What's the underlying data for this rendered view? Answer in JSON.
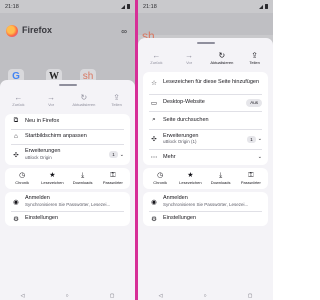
{
  "left": {
    "status": {
      "time": "21:18"
    },
    "home": {
      "brand": "Firefox"
    },
    "nav": [
      {
        "icon": "arrow-left",
        "glyph": "←",
        "label": "Zurück"
      },
      {
        "icon": "arrow-right",
        "glyph": "→",
        "label": "Vor"
      },
      {
        "icon": "reload",
        "glyph": "↻",
        "label": "Aktualisieren"
      },
      {
        "icon": "share",
        "glyph": "⇪",
        "label": "Teilen"
      }
    ],
    "menu1": [
      {
        "icon": "tab",
        "glyph": "⧉",
        "label": "Neu in Firefox"
      },
      {
        "icon": "home",
        "glyph": "⌂",
        "label": "Startbildschirm anpassen"
      }
    ],
    "extensions": {
      "label": "Erweiterungen",
      "sub": "uBlock Origin",
      "count": "1"
    },
    "quick": [
      {
        "icon": "clock",
        "glyph": "◷",
        "label": "Chronik"
      },
      {
        "icon": "star",
        "glyph": "★",
        "label": "Lesezeichen"
      },
      {
        "icon": "download",
        "glyph": "⤓",
        "label": "Downloads"
      },
      {
        "icon": "key",
        "glyph": "⚿",
        "label": "Passwörter"
      }
    ],
    "account": {
      "label": "Anmelden",
      "sub": "Synchronisieren Sie Passwörter, Lesezei..."
    },
    "settings": {
      "label": "Einstellungen"
    }
  },
  "right": {
    "status": {
      "time": "21:18"
    },
    "nav": [
      {
        "icon": "arrow-left",
        "glyph": "←",
        "label": "Zurück"
      },
      {
        "icon": "arrow-right",
        "glyph": "→",
        "label": "Vor"
      },
      {
        "icon": "reload",
        "glyph": "↻",
        "label": "Aktualisieren"
      },
      {
        "icon": "share",
        "glyph": "⇪",
        "label": "Teilen"
      }
    ],
    "bookmark": {
      "label": "Lesezeichen für diese Seite hinzufügen"
    },
    "desktop": {
      "label": "Desktop-Website",
      "state": "Aus"
    },
    "find": {
      "label": "Seite durchsuchen"
    },
    "extensions": {
      "label": "Erweiterungen",
      "sub": "uBlock Origin (1)",
      "count": "1"
    },
    "more": {
      "label": "Mehr"
    },
    "quick": [
      {
        "icon": "clock",
        "glyph": "◷",
        "label": "Chronik"
      },
      {
        "icon": "star",
        "glyph": "★",
        "label": "Lesezeichen"
      },
      {
        "icon": "download",
        "glyph": "⤓",
        "label": "Downloads"
      },
      {
        "icon": "key",
        "glyph": "⚿",
        "label": "Passwörter"
      }
    ],
    "account": {
      "label": "Anmelden",
      "sub": "Synchronisieren Sie Passwörter, Lesezei..."
    },
    "settings": {
      "label": "Einstellungen"
    }
  },
  "system_nav": [
    "◁",
    "○",
    "▢"
  ]
}
